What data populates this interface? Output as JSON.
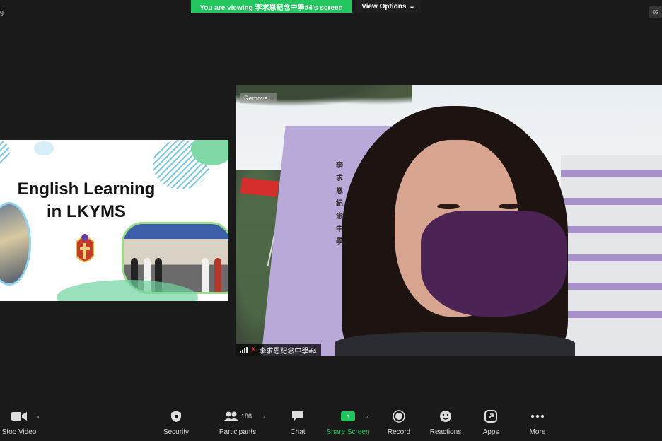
{
  "top_bar": {
    "left_text": "g",
    "viewing_banner": "You are viewing 李求恩紀念中學#4's screen",
    "view_options": "View Options",
    "right_text": "02"
  },
  "shared_screen": {
    "title_line1": "English Learning",
    "title_line2": "in LKYMS"
  },
  "video_tile": {
    "remove_label": "Remove...",
    "participant_name": "李求恩紀念中學#4",
    "building_sign": "李求恩紀念中學"
  },
  "toolbar": {
    "stop_video": "Stop Video",
    "security": "Security",
    "participants": "Participants",
    "participant_count": "188",
    "chat": "Chat",
    "share_screen": "Share Screen",
    "record": "Record",
    "reactions": "Reactions",
    "apps": "Apps",
    "more": "More"
  },
  "colors": {
    "accent_green": "#22c55e",
    "background": "#1a1a1a",
    "mask_purple": "#4b2354"
  }
}
